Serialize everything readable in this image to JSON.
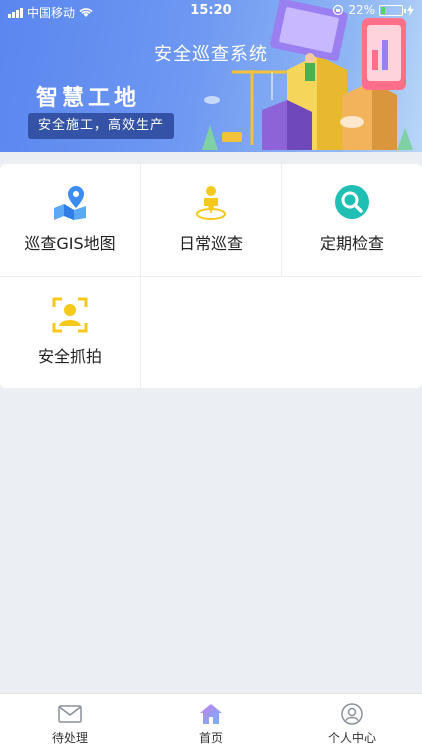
{
  "status_bar": {
    "carrier": "中国移动",
    "time": "15:20",
    "battery": "22%",
    "battery_level": 0.22
  },
  "header": {
    "title": "安全巡查系统",
    "big_title": "智慧工地",
    "slogan": "安全施工，高效生产"
  },
  "menu": {
    "items": [
      {
        "label": "巡查GIS地图",
        "icon": "map-pin-icon",
        "color": "#3c8cf0"
      },
      {
        "label": "日常巡查",
        "icon": "person-pin-icon",
        "color": "#f5c91c"
      },
      {
        "label": "定期检查",
        "icon": "magnifier-icon",
        "color": "#1fbfb4"
      },
      {
        "label": "安全抓拍",
        "icon": "face-capture-icon",
        "color": "#f5c91c"
      }
    ]
  },
  "tabbar": {
    "items": [
      {
        "label": "待处理",
        "icon": "mail-icon"
      },
      {
        "label": "首页",
        "icon": "home-icon"
      },
      {
        "label": "个人中心",
        "icon": "user-icon"
      }
    ]
  },
  "colors": {
    "banner_start": "#5a86ef",
    "banner_end": "#b9d7f7",
    "slogan_bg": "#3553a6",
    "page_bg": "#ebeef3"
  }
}
